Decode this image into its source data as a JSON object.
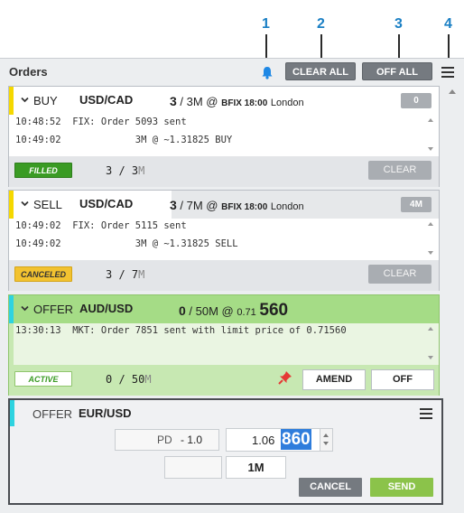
{
  "annotations": [
    "1",
    "2",
    "3",
    "4"
  ],
  "header": {
    "title": "Orders",
    "clear_all": "CLEAR ALL",
    "off_all": "OFF ALL"
  },
  "colors": {
    "buy_stripe": "#f5d800",
    "offer_stripe": "#2ed3e0",
    "offer_header": "#a5dc86",
    "filled": "#3a9b24",
    "canceled": "#f2c230",
    "active": "#ffffff",
    "send": "#8bc34a",
    "bell": "#1e88e5"
  },
  "orders": [
    {
      "side": "BUY",
      "pair": "USD/CAD",
      "qty_filled": "3",
      "qty_rest": " / 3M @ ",
      "fix": "BFIX 18:00",
      "loc": "London",
      "badge": "0",
      "log": [
        "10:48:52  FIX: Order 5093 sent",
        "10:49:02             3M @ ~1.31825 BUY"
      ],
      "status": "FILLED",
      "fill_a": "3 / 3",
      "fill_m": "M",
      "clear": "CLEAR"
    },
    {
      "side": "SELL",
      "pair": "USD/CAD",
      "qty_filled": "3",
      "qty_rest": " / 7M @ ",
      "fix": "BFIX 18:00",
      "loc": "London",
      "badge": "4M",
      "log": [
        "10:49:02  FIX: Order 5115 sent",
        "10:49:02             3M @ ~1.31825 SELL"
      ],
      "status": "CANCELED",
      "fill_a": "3 / 7",
      "fill_m": "M",
      "clear": "CLEAR"
    },
    {
      "side": "OFFER",
      "pair": "AUD/USD",
      "qty_filled": "0",
      "qty_rest": " / 50M @ ",
      "price_small": "0.71",
      "price_big": "560",
      "log": [
        "13:30:13  MKT: Order 7851 sent with limit price of 0.71560"
      ],
      "status": "ACTIVE",
      "fill_a": "0 / 50",
      "fill_m": "M",
      "amend": "AMEND",
      "off": "OFF"
    }
  ],
  "new_order": {
    "side": "OFFER",
    "pair": "EUR/USD",
    "pd_label": "PD",
    "pd_value": "- 1.0",
    "price_prefix": "1.06",
    "price_selected": "860",
    "amount": "1M",
    "cancel": "CANCEL",
    "send": "SEND"
  }
}
